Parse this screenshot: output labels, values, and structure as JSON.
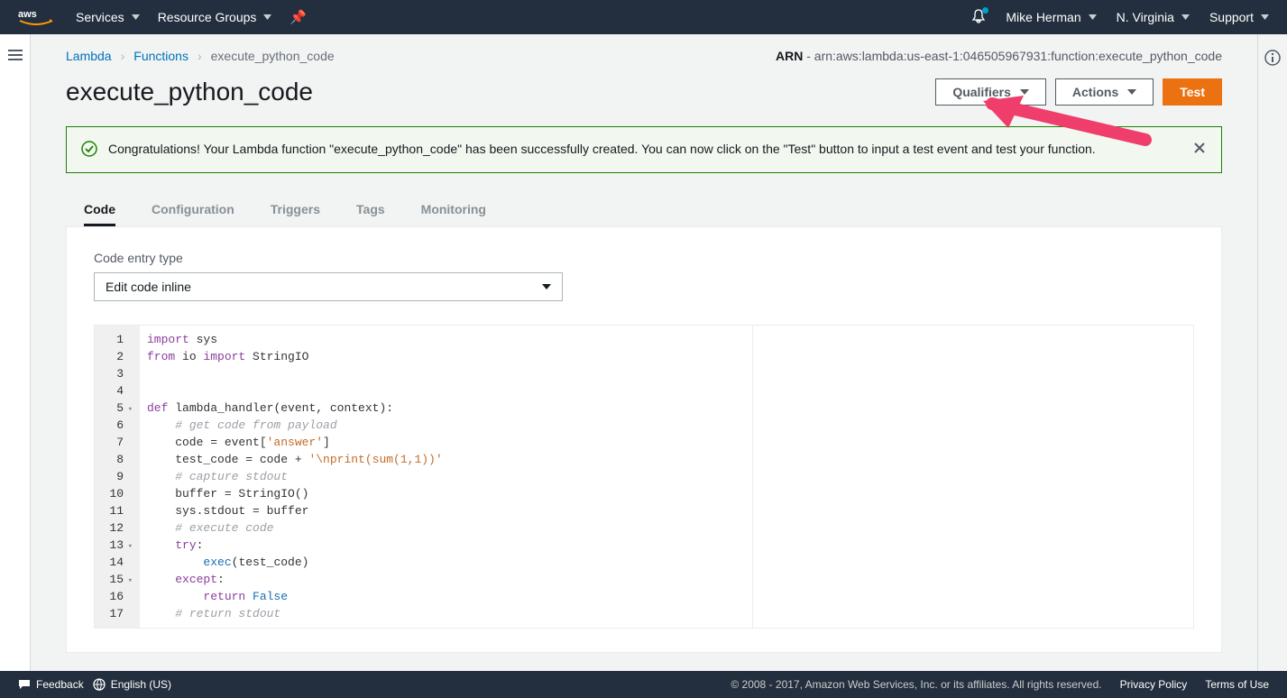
{
  "topnav": {
    "services": "Services",
    "resource_groups": "Resource Groups",
    "user": "Mike Herman",
    "region": "N. Virginia",
    "support": "Support"
  },
  "breadcrumb": {
    "root": "Lambda",
    "mid": "Functions",
    "current": "execute_python_code"
  },
  "arn": {
    "label": "ARN",
    "value": "arn:aws:lambda:us-east-1:046505967931:function:execute_python_code"
  },
  "page_title": "execute_python_code",
  "buttons": {
    "qualifiers": "Qualifiers",
    "actions": "Actions",
    "test": "Test"
  },
  "alert": {
    "text": "Congratulations! Your Lambda function \"execute_python_code\" has been successfully created. You can now click on the \"Test\" button to input a test event and test your function."
  },
  "tabs": {
    "code": "Code",
    "configuration": "Configuration",
    "triggers": "Triggers",
    "tags": "Tags",
    "monitoring": "Monitoring"
  },
  "code_entry": {
    "label": "Code entry type",
    "value": "Edit code inline"
  },
  "editor": {
    "lines": [
      {
        "n": "1",
        "tokens": [
          {
            "t": "import ",
            "c": "kw"
          },
          {
            "t": "sys",
            "c": ""
          }
        ]
      },
      {
        "n": "2",
        "tokens": [
          {
            "t": "from ",
            "c": "kw"
          },
          {
            "t": "io ",
            "c": ""
          },
          {
            "t": "import ",
            "c": "kw"
          },
          {
            "t": "StringIO",
            "c": ""
          }
        ]
      },
      {
        "n": "3",
        "tokens": []
      },
      {
        "n": "4",
        "tokens": []
      },
      {
        "n": "5",
        "fold": true,
        "tokens": [
          {
            "t": "def ",
            "c": "kw"
          },
          {
            "t": "lambda_handler",
            "c": "fn"
          },
          {
            "t": "(event, context):",
            "c": ""
          }
        ]
      },
      {
        "n": "6",
        "tokens": [
          {
            "t": "    ",
            "c": ""
          },
          {
            "t": "# get code from payload",
            "c": "cm"
          }
        ]
      },
      {
        "n": "7",
        "tokens": [
          {
            "t": "    code = event[",
            "c": ""
          },
          {
            "t": "'answer'",
            "c": "st"
          },
          {
            "t": "]",
            "c": ""
          }
        ]
      },
      {
        "n": "8",
        "tokens": [
          {
            "t": "    test_code = code + ",
            "c": ""
          },
          {
            "t": "'\\nprint(sum(1,1))'",
            "c": "st"
          }
        ]
      },
      {
        "n": "9",
        "tokens": [
          {
            "t": "    ",
            "c": ""
          },
          {
            "t": "# capture stdout",
            "c": "cm"
          }
        ]
      },
      {
        "n": "10",
        "tokens": [
          {
            "t": "    buffer = StringIO()",
            "c": ""
          }
        ]
      },
      {
        "n": "11",
        "tokens": [
          {
            "t": "    sys.stdout = buffer",
            "c": ""
          }
        ]
      },
      {
        "n": "12",
        "tokens": [
          {
            "t": "    ",
            "c": ""
          },
          {
            "t": "# execute code",
            "c": "cm"
          }
        ]
      },
      {
        "n": "13",
        "fold": true,
        "tokens": [
          {
            "t": "    ",
            "c": ""
          },
          {
            "t": "try",
            "c": "kw"
          },
          {
            "t": ":",
            "c": ""
          }
        ]
      },
      {
        "n": "14",
        "tokens": [
          {
            "t": "        ",
            "c": ""
          },
          {
            "t": "exec",
            "c": "bl"
          },
          {
            "t": "(test_code)",
            "c": ""
          }
        ]
      },
      {
        "n": "15",
        "fold": true,
        "tokens": [
          {
            "t": "    ",
            "c": ""
          },
          {
            "t": "except",
            "c": "kw"
          },
          {
            "t": ":",
            "c": ""
          }
        ]
      },
      {
        "n": "16",
        "tokens": [
          {
            "t": "        ",
            "c": ""
          },
          {
            "t": "return ",
            "c": "kw"
          },
          {
            "t": "False",
            "c": "bl"
          }
        ]
      },
      {
        "n": "17",
        "tokens": [
          {
            "t": "    ",
            "c": ""
          },
          {
            "t": "# return stdout",
            "c": "cm"
          }
        ]
      }
    ]
  },
  "footer": {
    "feedback": "Feedback",
    "language": "English (US)",
    "copyright": "© 2008 - 2017, Amazon Web Services, Inc. or its affiliates. All rights reserved.",
    "privacy": "Privacy Policy",
    "terms": "Terms of Use"
  }
}
